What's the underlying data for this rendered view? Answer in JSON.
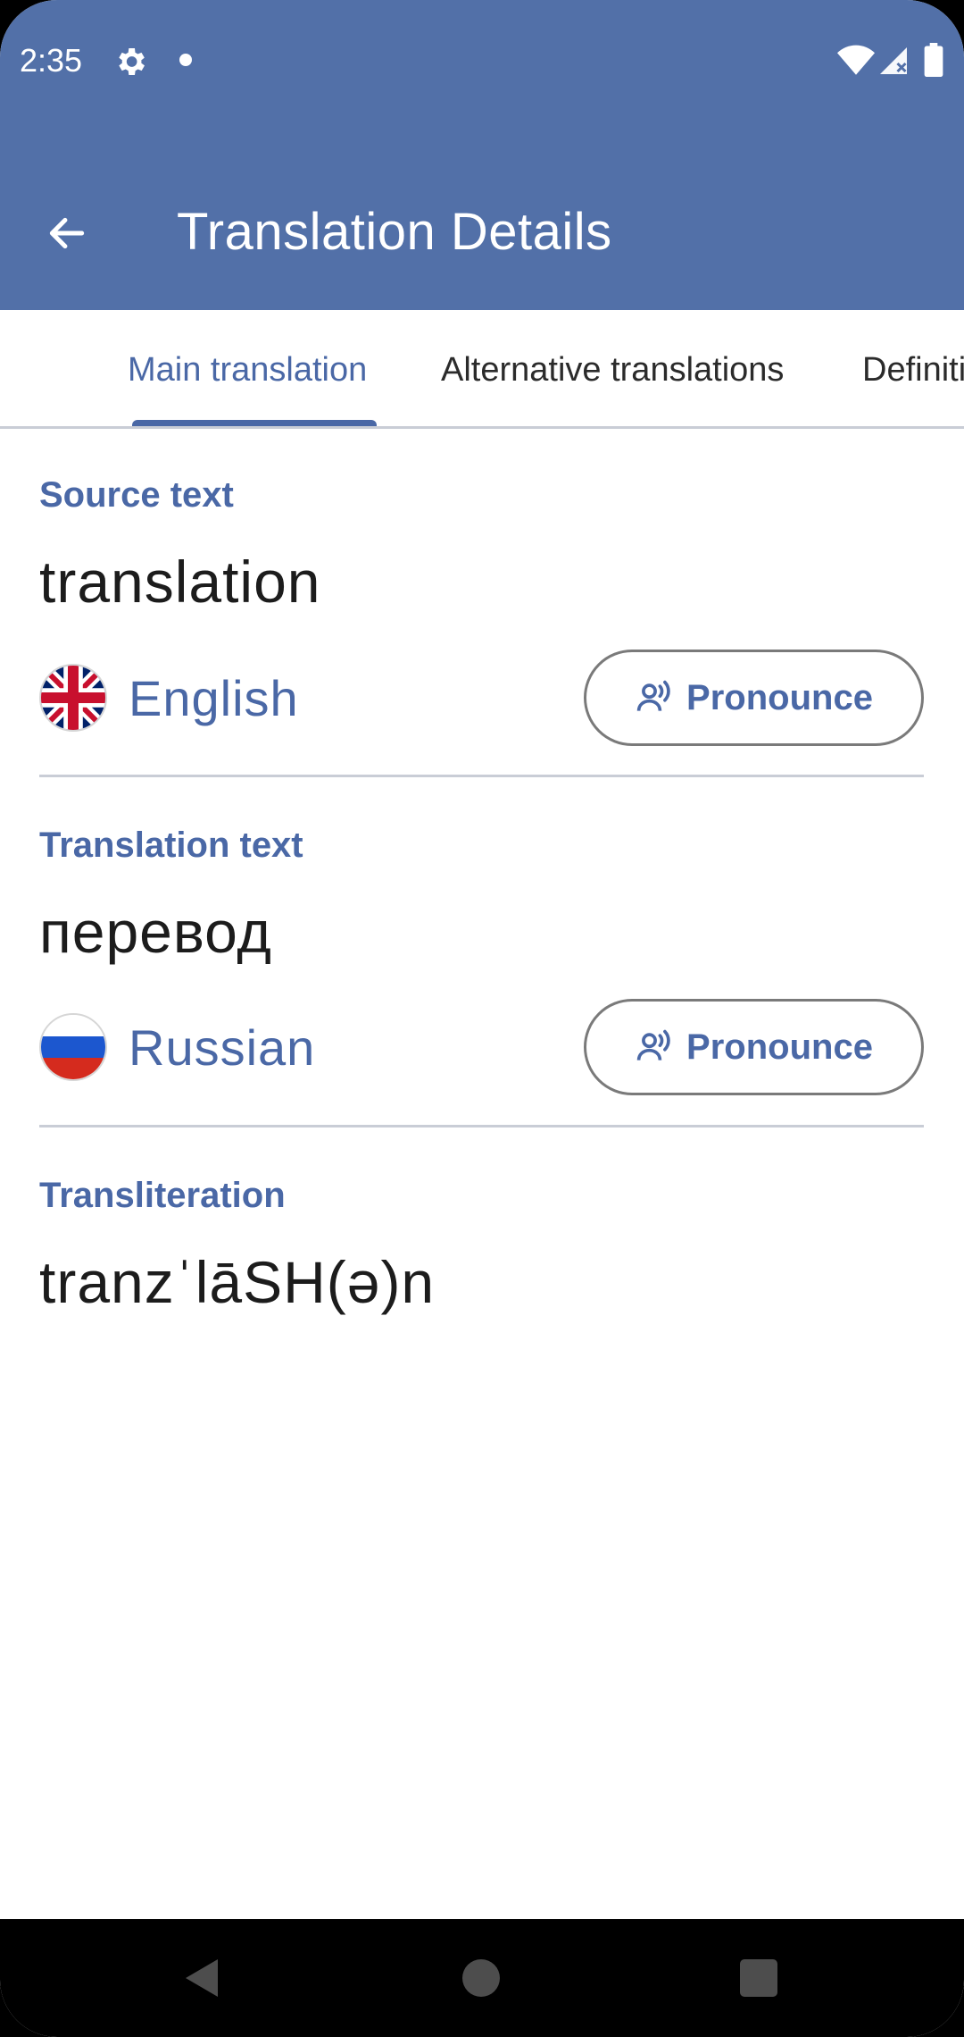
{
  "status_bar": {
    "time": "2:35",
    "icons": [
      "settings-gear-icon",
      "notification-dot-icon",
      "wifi-icon",
      "signal-icon",
      "battery-icon"
    ]
  },
  "app_bar": {
    "title": "Translation Details",
    "back_icon": "arrow-back-icon"
  },
  "tabs": [
    {
      "label": "Main translation",
      "active": true
    },
    {
      "label": "Alternative translations",
      "active": false
    },
    {
      "label": "Definitions",
      "active": false
    }
  ],
  "source": {
    "label": "Source text",
    "text": "translation",
    "language": "English",
    "flag": "uk-flag-icon",
    "pronounce_label": "Pronounce"
  },
  "translation": {
    "label": "Translation text",
    "text": "перевод",
    "language": "Russian",
    "flag": "russia-flag-icon",
    "pronounce_label": "Pronounce"
  },
  "transliteration": {
    "label": "Transliteration",
    "text": "tranzˈlāSH(ə)n"
  },
  "colors": {
    "primary": "#5270a8",
    "accent": "#4a68a6",
    "text": "#1c1c1c",
    "divider": "#c9cdd6"
  }
}
